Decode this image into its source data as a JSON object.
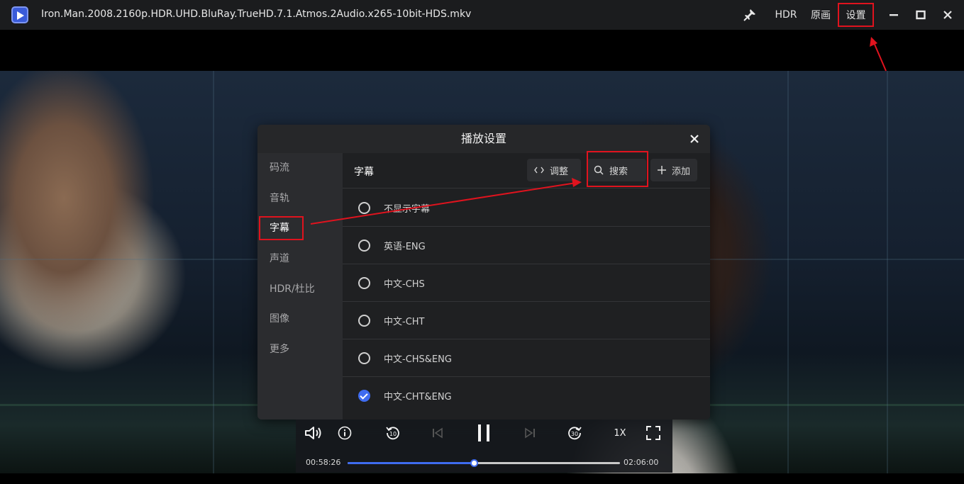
{
  "window": {
    "file_title": "Iron.Man.2008.2160p.HDR.UHD.BluRay.TrueHD.7.1.Atmos.2Audio.x265-10bit-HDS.mkv",
    "hdr_label": "HDR",
    "original_label": "原画",
    "settings_label": "设置",
    "pin_icon": "pin-icon",
    "minimize_icon": "minimize-icon",
    "maximize_icon": "maximize-icon",
    "close_icon": "close-icon"
  },
  "dialog": {
    "title": "播放设置",
    "nav": [
      {
        "label": "码流"
      },
      {
        "label": "音轨"
      },
      {
        "label": "字幕"
      },
      {
        "label": "声道"
      },
      {
        "label": "HDR/杜比"
      },
      {
        "label": "图像"
      },
      {
        "label": "更多"
      }
    ],
    "active_nav": "字幕",
    "panel": {
      "title": "字幕",
      "adjust_label": "调整",
      "search_label": "搜索",
      "add_label": "添加",
      "subtitles": [
        {
          "label": "不显示字幕",
          "selected": false
        },
        {
          "label": "英语-ENG",
          "selected": false
        },
        {
          "label": "中文-CHS",
          "selected": false
        },
        {
          "label": "中文-CHT",
          "selected": false
        },
        {
          "label": "中文-CHS&ENG",
          "selected": false
        },
        {
          "label": "中文-CHT&ENG",
          "selected": true
        }
      ]
    }
  },
  "player": {
    "current_time": "00:58:26",
    "total_time": "02:06:00",
    "progress_fraction": 0.464,
    "speed_label": "1X"
  },
  "colors": {
    "accent": "#3f6cf0",
    "highlight": "#e0131e"
  }
}
